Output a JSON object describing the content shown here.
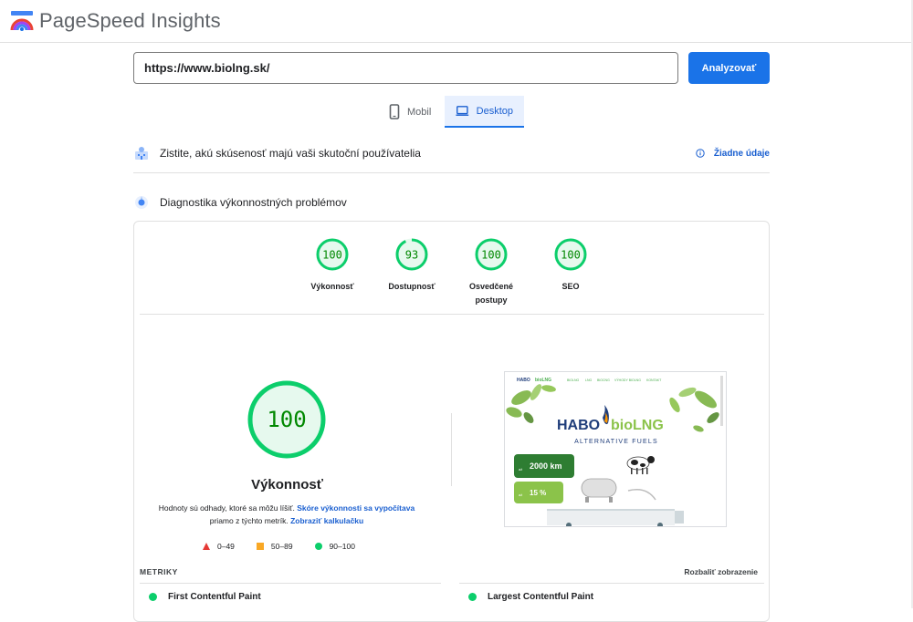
{
  "app": {
    "title": "PageSpeed Insights"
  },
  "search": {
    "url_value": "https://www.biolng.sk/",
    "analyze_label": "Analyzovať"
  },
  "tabs": [
    {
      "label": "Mobil",
      "icon": "smartphone-icon",
      "active": false
    },
    {
      "label": "Desktop",
      "icon": "laptop-icon",
      "active": true
    }
  ],
  "real_users": {
    "heading": "Zistite, akú skúsenosť majú vaši skutoční používatelia",
    "no_data_label": "Žiadne údaje",
    "icon": "info-icon"
  },
  "diagnostics": {
    "heading": "Diagnostika výkonnostných problémov"
  },
  "scores": [
    {
      "label": "Výkonnosť",
      "value": "100"
    },
    {
      "label": "Dostupnosť",
      "value": "93"
    },
    {
      "label": "Osvedčené postupy",
      "value": "100"
    },
    {
      "label": "SEO",
      "value": "100"
    }
  ],
  "performance": {
    "score": "100",
    "title": "Výkonnosť",
    "desc_text_1": "Hodnoty sú odhady, ktoré sa môžu líšiť.",
    "desc_link_1": "Skóre výkonnosti sa vypočítava",
    "desc_text_2": "priamo z týchto metrík.",
    "desc_link_2": "Zobraziť kalkulačku",
    "legend": [
      {
        "range": "0–49",
        "marker": "triangle",
        "color": "#e53935"
      },
      {
        "range": "50–89",
        "marker": "square",
        "color": "#f9a825"
      },
      {
        "range": "90–100",
        "marker": "circle",
        "color": "#0cce6b"
      }
    ]
  },
  "screenshot": {
    "nav_items": [
      "BIOLNG",
      "LNG",
      "BIOCNG",
      "VÝHODY BIOLNG",
      "KONTAKT"
    ],
    "brand_left": "HABO",
    "brand_right": "bioLNG",
    "tagline": "ALTERNATIVE FUELS",
    "badge_1_value": "2000 km",
    "badge_1_prefix": "až",
    "badge_2_value": "15 %",
    "badge_2_prefix": "až"
  },
  "metrics": {
    "label": "METRIKY",
    "expand_label": "Rozbaliť zobrazenie",
    "items": [
      "First Contentful Paint",
      "Largest Contentful Paint"
    ]
  },
  "colors": {
    "good": "#0cce6b",
    "good_text": "#008800",
    "accent": "#1a73e8"
  }
}
